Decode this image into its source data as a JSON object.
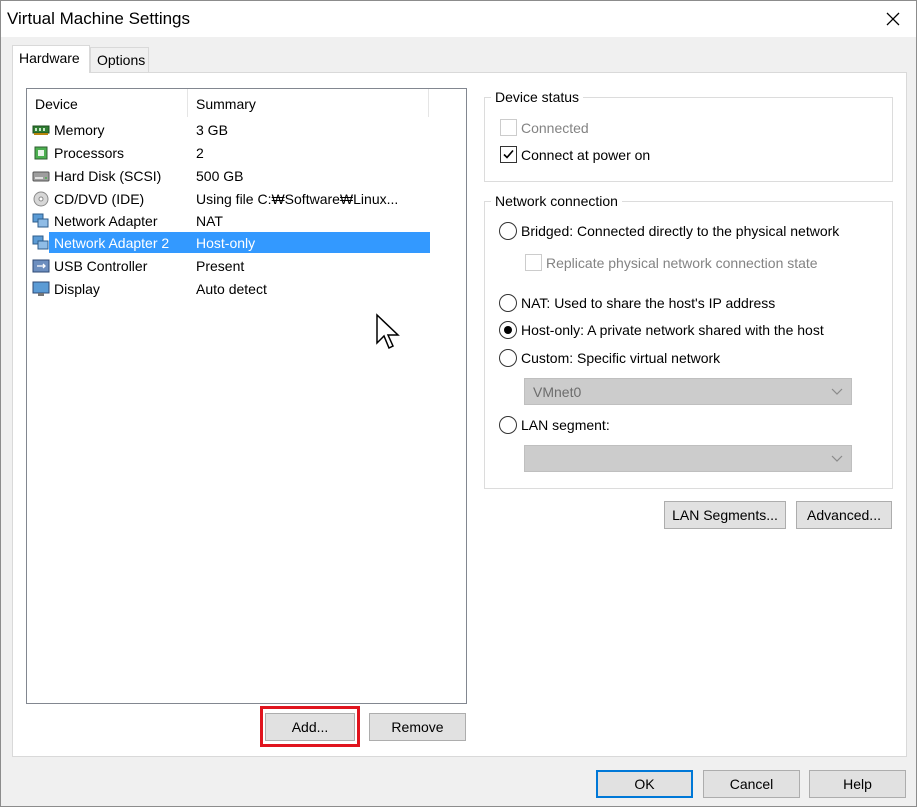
{
  "window": {
    "title": "Virtual Machine Settings"
  },
  "tabs": [
    {
      "label": "Hardware",
      "active": true
    },
    {
      "label": "Options",
      "active": false
    }
  ],
  "device_list": {
    "columns": [
      "Device",
      "Summary"
    ],
    "rows": [
      {
        "device": "Memory",
        "summary": "3 GB",
        "icon": "memory-icon"
      },
      {
        "device": "Processors",
        "summary": "2",
        "icon": "processor-icon"
      },
      {
        "device": "Hard Disk (SCSI)",
        "summary": "500 GB",
        "icon": "hard-disk-icon"
      },
      {
        "device": "CD/DVD (IDE)",
        "summary": "Using file C:₩Software₩Linux...",
        "icon": "cd-dvd-icon"
      },
      {
        "device": "Network Adapter",
        "summary": "NAT",
        "icon": "network-adapter-icon"
      },
      {
        "device": "Network Adapter 2",
        "summary": "Host-only",
        "icon": "network-adapter-icon",
        "selected": true
      },
      {
        "device": "USB Controller",
        "summary": "Present",
        "icon": "usb-icon"
      },
      {
        "device": "Display",
        "summary": "Auto detect",
        "icon": "display-icon"
      }
    ]
  },
  "list_buttons": {
    "add": "Add...",
    "remove": "Remove"
  },
  "device_status": {
    "title": "Device status",
    "connected_label": "Connected",
    "connected_checked": false,
    "connected_enabled": false,
    "power_on_label": "Connect at power on",
    "power_on_checked": true
  },
  "network_connection": {
    "title": "Network connection",
    "bridged_label": "Bridged: Connected directly to the physical network",
    "replicate_label": "Replicate physical network connection state",
    "nat_label": "NAT: Used to share the host's IP address",
    "host_only_label": "Host-only: A private network shared with the host",
    "custom_label": "Custom: Specific virtual network",
    "custom_select_value": "VMnet0",
    "lan_segment_label": "LAN segment:",
    "lan_segment_select_value": "",
    "selected": "host-only"
  },
  "network_buttons": {
    "lan_segments": "LAN Segments...",
    "advanced": "Advanced..."
  },
  "footer": {
    "ok": "OK",
    "cancel": "Cancel",
    "help": "Help"
  },
  "colors": {
    "selection": "#3399ff",
    "highlight_box": "#e0141e",
    "default_button_border": "#0078d7"
  }
}
